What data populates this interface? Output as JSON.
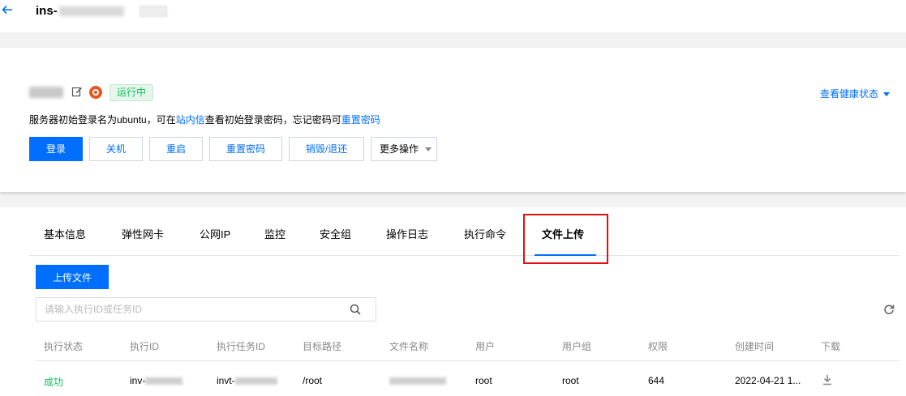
{
  "header": {
    "back_icon": "arrow-left-icon",
    "title_prefix": "ins-"
  },
  "instance": {
    "status": "运行中",
    "os_icon": "ubuntu-icon",
    "edit_icon": "edit-icon",
    "health_link": "查看健康状态",
    "tip_part1": "服务器初始登录名为ubuntu，可在",
    "tip_link1": "站内信",
    "tip_part2": "查看初始登录密码，忘记密码可",
    "tip_link2": "重置密码"
  },
  "actions": {
    "login": "登录",
    "shutdown": "关机",
    "reboot": "重启",
    "reset_password": "重置密码",
    "destroy": "销毁/退还",
    "more": "更多操作"
  },
  "tabs": [
    "基本信息",
    "弹性网卡",
    "公网IP",
    "监控",
    "安全组",
    "操作日志",
    "执行命令",
    "文件上传"
  ],
  "upload": {
    "button": "上传文件",
    "search_placeholder": "请输入执行ID或任务ID"
  },
  "table": {
    "columns": [
      "执行状态",
      "执行ID",
      "执行任务ID",
      "目标路径",
      "文件名称",
      "用户",
      "用户组",
      "权限",
      "创建时间",
      "下载"
    ],
    "rows": [
      {
        "status": "成功",
        "exec_id_prefix": "inv-",
        "task_id_prefix": "invt-",
        "path": "/root",
        "user": "root",
        "group": "root",
        "permission": "644",
        "created": "2022-04-21 1..."
      }
    ]
  },
  "colors": {
    "accent": "#006eff",
    "success": "#0abf5b",
    "highlight": "#e01010"
  }
}
